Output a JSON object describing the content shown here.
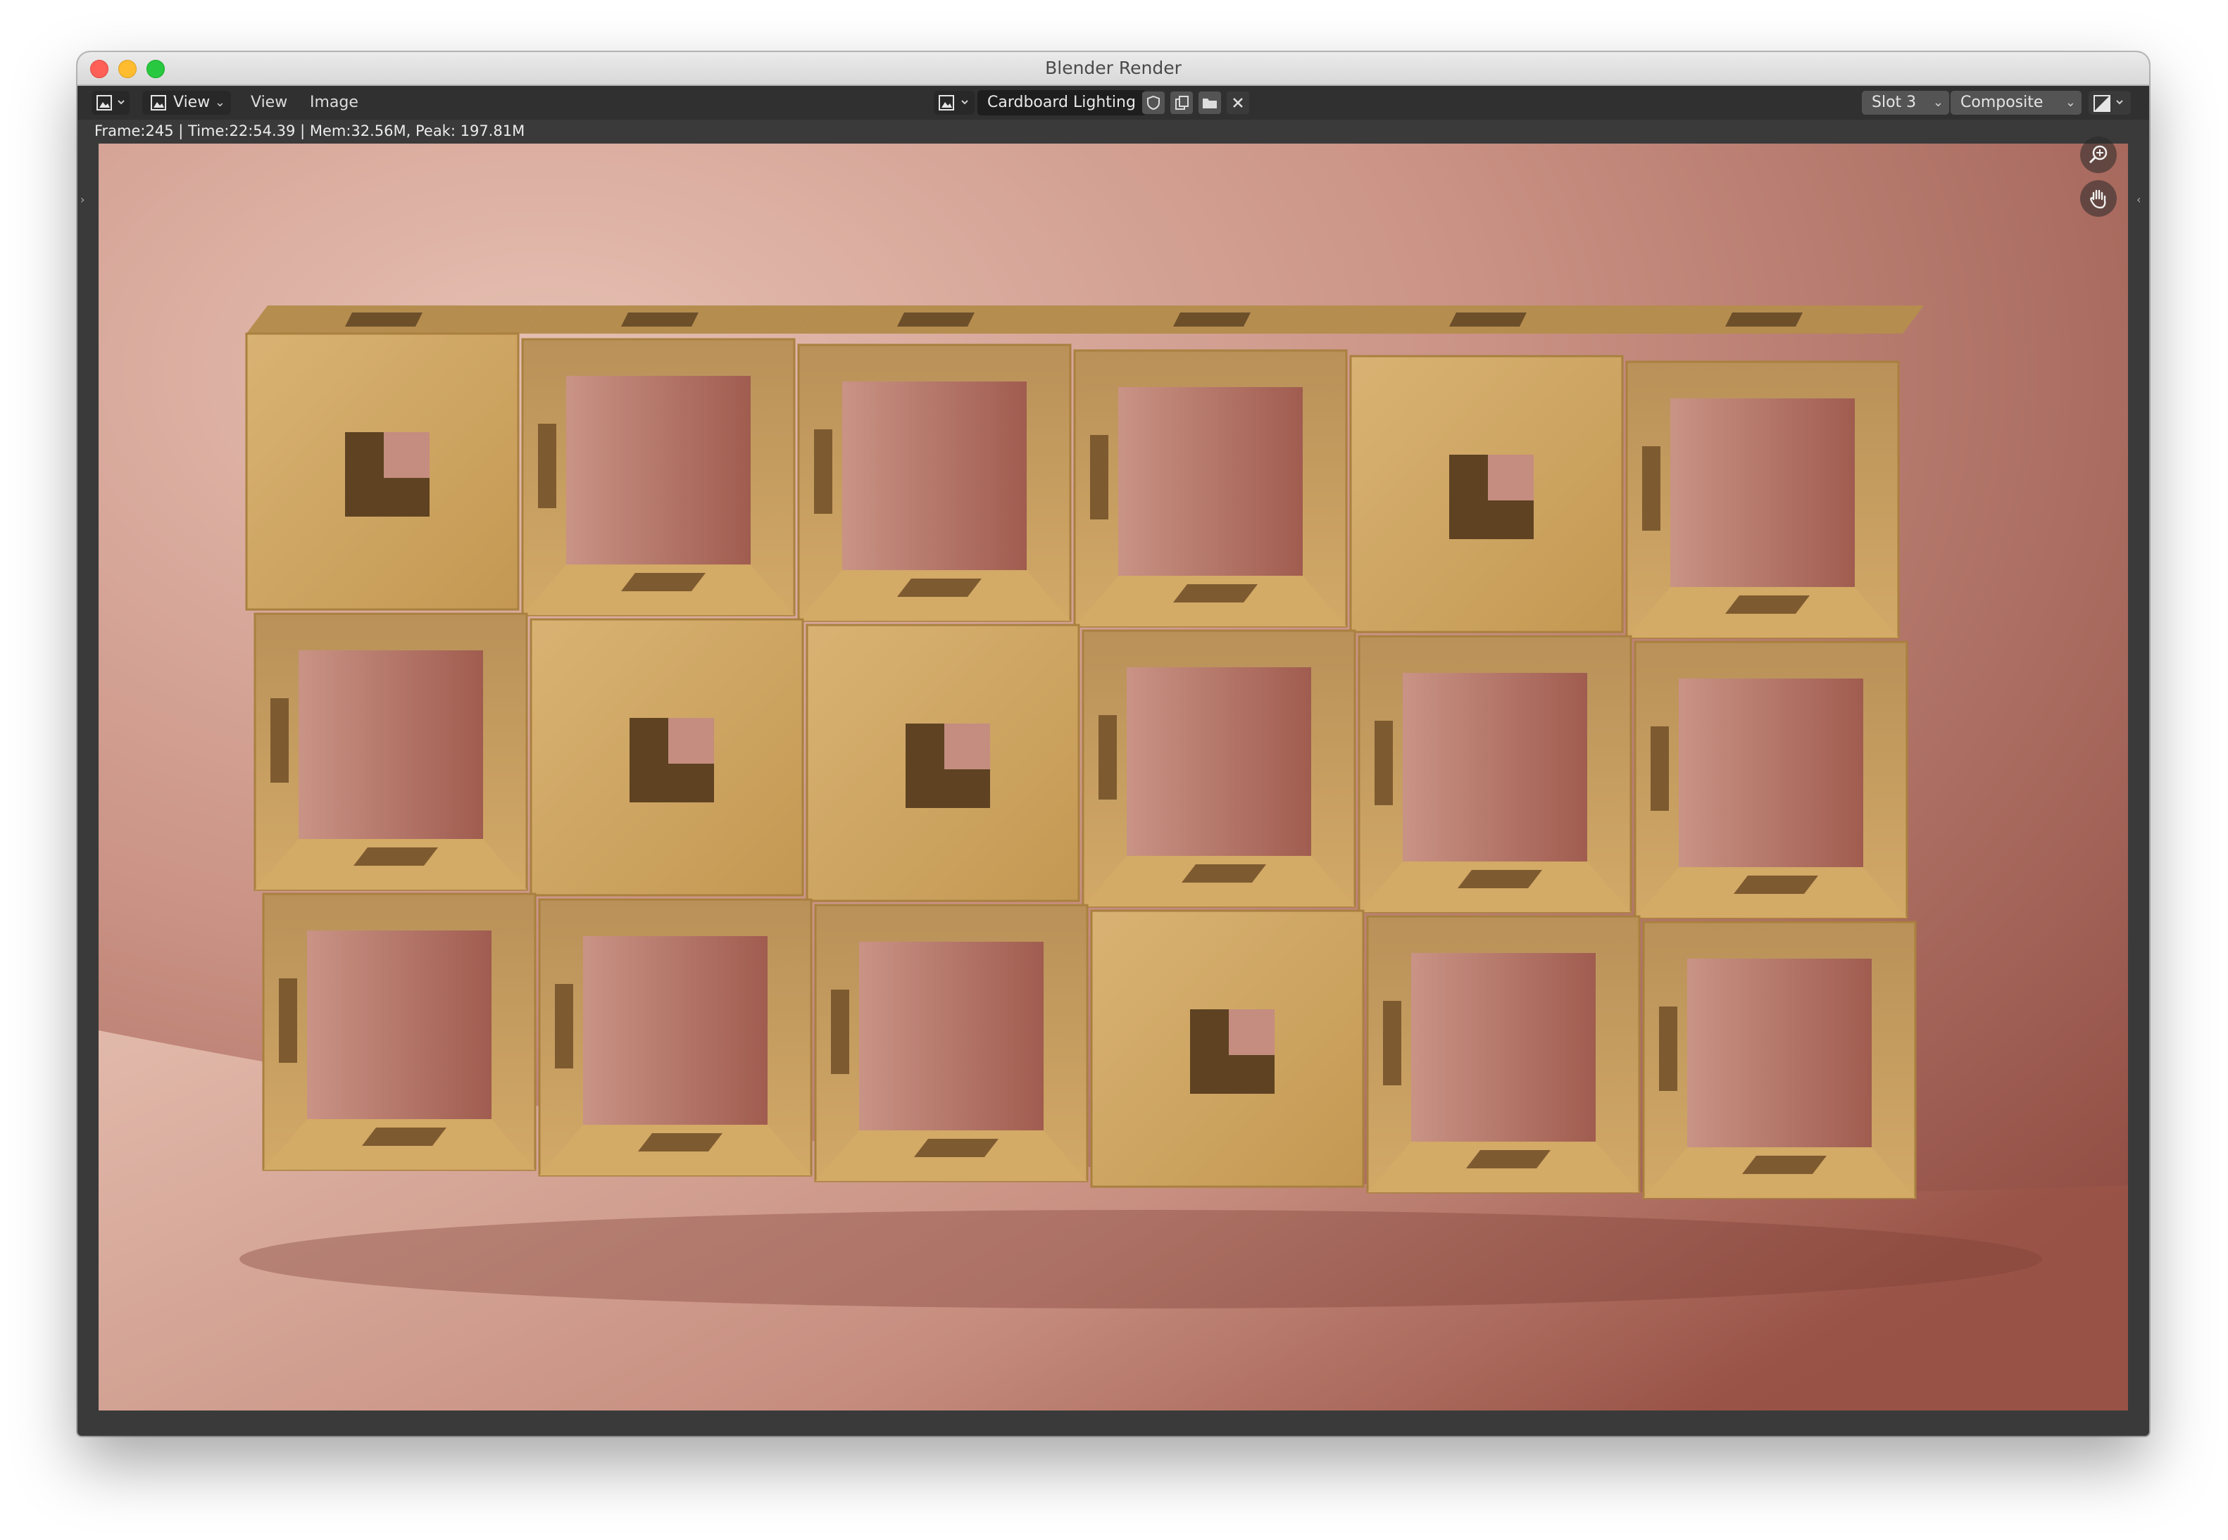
{
  "window": {
    "title": "Blender Render"
  },
  "header": {
    "editor_type_icon": "image-editor-icon",
    "view_mode_label": "View",
    "menus": [
      "View",
      "Image"
    ],
    "image_name": "Cardboard Lighting",
    "slot_label": "Slot 3",
    "layer_label": "Composite"
  },
  "status": {
    "text": "Frame:245 | Time:22:54.39 | Mem:32.56M, Peak: 197.81M"
  },
  "render": {
    "subject": "cardboard-cube-shelf",
    "grid_rows": 3,
    "grid_cols": 6,
    "background_color": "#c99183",
    "cardboard_color": "#c9a058",
    "cardboard_face_color": "#d6b070"
  }
}
